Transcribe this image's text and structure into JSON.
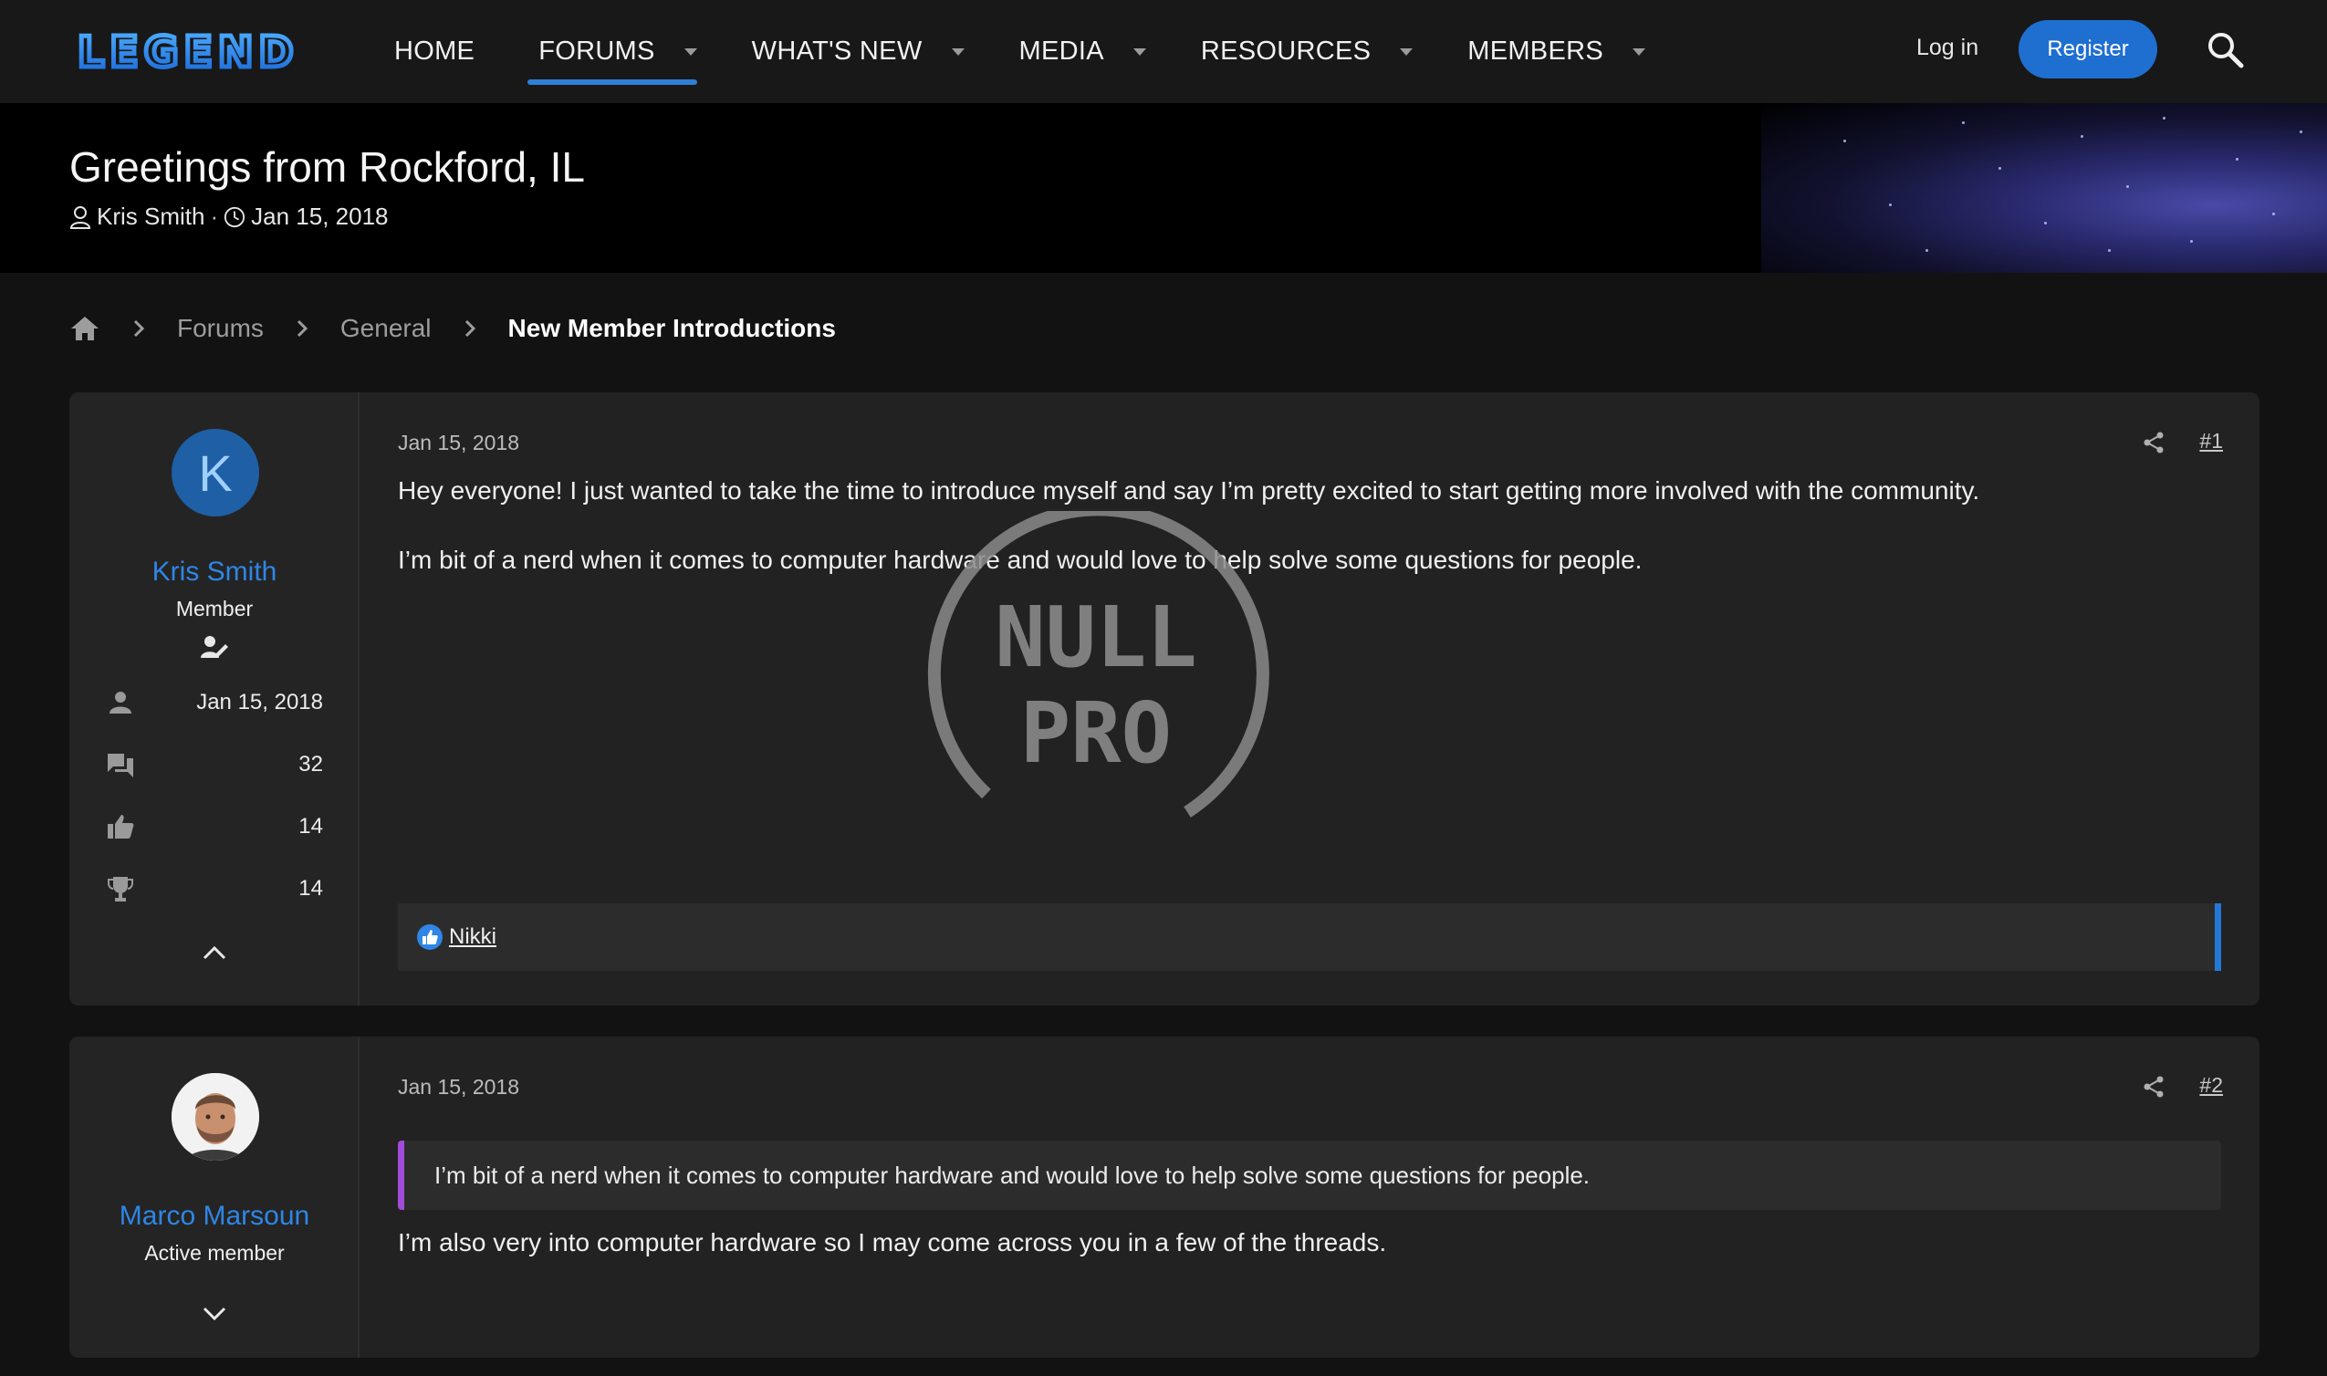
{
  "nav": {
    "logo_text": "LEGEND",
    "items": [
      {
        "label": "HOME",
        "has_menu": false,
        "active": false
      },
      {
        "label": "FORUMS",
        "has_menu": true,
        "active": true
      },
      {
        "label": "WHAT'S NEW",
        "has_menu": true,
        "active": false
      },
      {
        "label": "MEDIA",
        "has_menu": true,
        "active": false
      },
      {
        "label": "RESOURCES",
        "has_menu": true,
        "active": false
      },
      {
        "label": "MEMBERS",
        "has_menu": true,
        "active": false
      }
    ],
    "login_label": "Log in",
    "register_label": "Register",
    "accent_color": "#1f6fd1"
  },
  "thread": {
    "title": "Greetings from Rockford, IL",
    "author": "Kris Smith",
    "separator": "·",
    "date": "Jan 15, 2018"
  },
  "breadcrumb": {
    "items": [
      "Forums",
      "General",
      "New Member Introductions"
    ]
  },
  "posts": [
    {
      "user": {
        "avatar_letter": "K",
        "name": "Kris Smith",
        "title": "Member",
        "joined": "Jan 15, 2018",
        "messages": "32",
        "reaction_score": "14",
        "points": "14"
      },
      "date": "Jan 15, 2018",
      "number": "#1",
      "paragraphs": [
        "Hey everyone! I just wanted to take the time to introduce myself and say I’m pretty excited to start getting more involved with the community.",
        "I’m bit of a nerd when it comes to computer hardware and would love to help solve some questions for people."
      ],
      "reactions_by": "Nikki"
    },
    {
      "user": {
        "name": "Marco Marsoun",
        "title": "Active member"
      },
      "date": "Jan 15, 2018",
      "number": "#2",
      "quote": "I’m bit of a nerd when it comes to computer hardware and would love to help solve some questions for people.",
      "paragraphs": [
        "I’m also very into computer hardware so I may come across you in a few of the threads."
      ]
    }
  ],
  "watermark": {
    "line1": "NULL",
    "line2": "PRO"
  }
}
